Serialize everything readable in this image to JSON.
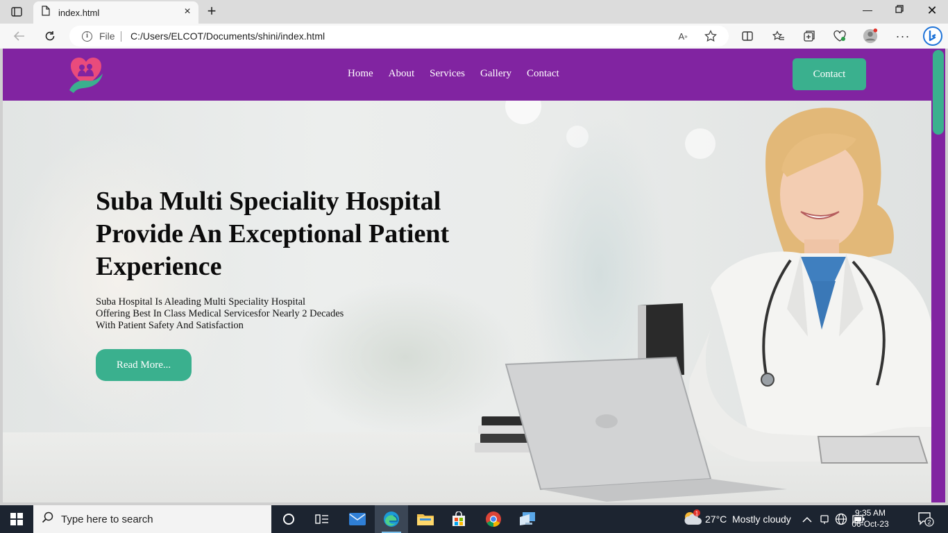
{
  "browser": {
    "tab_title": "index.html",
    "url_scheme_label": "File",
    "url": "C:/Users/ELCOT/Documents/shini/index.html",
    "window_controls": [
      "minimize",
      "restore",
      "close"
    ]
  },
  "site": {
    "nav": {
      "items": [
        {
          "label": "Home"
        },
        {
          "label": "About"
        },
        {
          "label": "Services"
        },
        {
          "label": "Gallery"
        },
        {
          "label": "Contact"
        }
      ],
      "contact_button": "Contact"
    },
    "hero": {
      "title": "Suba Multi Speciality Hospital Provide An Exceptional Patient Experience",
      "text_lines": [
        "Suba Hospital Is Aleading Multi Speciality Hospital",
        "Offering Best In Class Medical Servicesfor Nearly 2 Decades",
        "With Patient Safety And Satisfaction"
      ],
      "button": "Read More..."
    },
    "colors": {
      "brand_purple": "#8124a1",
      "accent_green": "#3ab08e"
    }
  },
  "taskbar": {
    "search_placeholder": "Type here to search",
    "weather_temp": "27°C",
    "weather_desc": "Mostly cloudy",
    "time": "9:35 AM",
    "date": "06-Oct-23",
    "notification_count": "2",
    "weather_badge": "1"
  }
}
